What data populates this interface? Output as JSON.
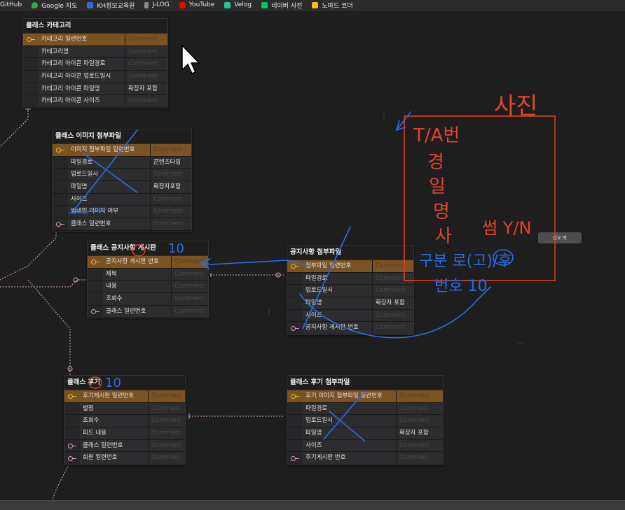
{
  "bookmarks": [
    {
      "label": "GitHub",
      "icon": "github-icon",
      "color": "#2b2b2d"
    },
    {
      "label": "Google 지도",
      "icon": "maps-pin-icon",
      "color": "#34a853"
    },
    {
      "label": "KH정보교육원",
      "icon": "kh-icon",
      "color": "#3b6cc8"
    },
    {
      "label": "J-LOG",
      "icon": "jlog-icon",
      "color": "#888888"
    },
    {
      "label": "YouTube",
      "icon": "youtube-icon",
      "color": "#ff0000"
    },
    {
      "label": "Velog",
      "icon": "velog-icon",
      "color": "#20c997"
    },
    {
      "label": "네이버 사전",
      "icon": "naver-icon",
      "color": "#03c75a"
    },
    {
      "label": "노마드 코더",
      "icon": "nomad-icon",
      "color": "#f4c20d"
    }
  ],
  "tables": {
    "category": {
      "title": "클래스 카테고리",
      "rows": [
        {
          "name": "카테고리 일련번호",
          "comment": "Comment"
        },
        {
          "name": "카테고리명",
          "comment": "Comment"
        },
        {
          "name": "카테고리 아이콘 파일경로",
          "comment": "Comment"
        },
        {
          "name": "카테고리 아이콘 업로드일시",
          "comment": "Comment"
        },
        {
          "name": "카테고리 아이콘 파일명",
          "comment": "확장자 포함"
        },
        {
          "name": "카테고리 아이콘 사이즈",
          "comment": "Comment"
        }
      ]
    },
    "image": {
      "title": "클래스 이미지 첨부파일",
      "rows": [
        {
          "name": "이미지 첨부파일 일련번호",
          "comment": "Comment"
        },
        {
          "name": "파일경로",
          "comment": "콘텐츠타입"
        },
        {
          "name": "업로드일시",
          "comment": "Comment"
        },
        {
          "name": "파일명",
          "comment": "확장자포함"
        },
        {
          "name": "사이즈",
          "comment": "Comment"
        },
        {
          "name": "썸네일 이미지 여부",
          "comment": "Comment"
        },
        {
          "name": "클래스 일련번호",
          "comment": "Comment"
        }
      ]
    },
    "notice": {
      "title": "클래스 공지사항 게시판",
      "rows": [
        {
          "name": "공지사항 게시판 번호",
          "comment": "Comment"
        },
        {
          "name": "제목",
          "comment": "Comment"
        },
        {
          "name": "내용",
          "comment": "Comment"
        },
        {
          "name": "조회수",
          "comment": "Comment"
        },
        {
          "name": "클래스 일련번호",
          "comment": "Comment"
        }
      ]
    },
    "noticeFile": {
      "title": "공지사항 첨부파일",
      "rows": [
        {
          "name": "첨부파일 일련번호",
          "comment": "Comment"
        },
        {
          "name": "파일경로",
          "comment": "Comment"
        },
        {
          "name": "업로드일시",
          "comment": "Comment"
        },
        {
          "name": "파일명",
          "comment": "확장자 포함"
        },
        {
          "name": "사이즈",
          "comment": "Comment"
        },
        {
          "name": "공지사항 게시판 번호",
          "comment": "Comment"
        }
      ]
    },
    "review": {
      "title": "클래스 후기",
      "rows": [
        {
          "name": "후기게시판 일련번호",
          "comment": "Comment"
        },
        {
          "name": "별점",
          "comment": "Comment"
        },
        {
          "name": "조회수",
          "comment": "Comment"
        },
        {
          "name": "피드 내용",
          "comment": "Comment"
        },
        {
          "name": "클래스 일련번호",
          "comment": "Comment"
        },
        {
          "name": "회원 일련번호",
          "comment": "Comment"
        }
      ]
    },
    "reviewFile": {
      "title": "클래스 후기 첨부파일",
      "rows": [
        {
          "name": "후기 이미지 첨부파일 일련번호",
          "comment": "Comment"
        },
        {
          "name": "파일경로",
          "comment": "Comment"
        },
        {
          "name": "업로드일시",
          "comment": "Comment"
        },
        {
          "name": "파일명",
          "comment": "확장자 포함"
        },
        {
          "name": "사이즈",
          "comment": "Comment"
        },
        {
          "name": "후기게시판 번호",
          "comment": "Comment"
        }
      ]
    }
  },
  "annotations": {
    "photo_title": "사진",
    "list": [
      "T/A번",
      "경",
      "일",
      "명",
      "사"
    ],
    "yn": "썸 Y/N",
    "extra": "구분 로(고)/후",
    "number": "번호 10",
    "notice_mark": "10",
    "review_mark": "10"
  },
  "tooltip": "신우 박",
  "colors": {
    "pk_row": "#7b5222",
    "relation_line": "#d7a9c2",
    "pen_blue": "#2f6be0",
    "pen_red": "#e0442b",
    "canvas": "#1f1e1f"
  }
}
